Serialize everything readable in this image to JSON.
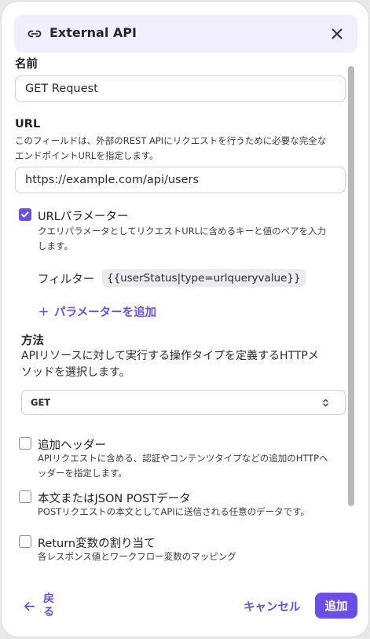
{
  "header": {
    "title": "External API"
  },
  "name_field": {
    "label": "名前",
    "value": "GET Request"
  },
  "url_field": {
    "label": "URL",
    "description_line1": "このフィールドは、外部のREST APIにリクエストを行うために必要な完全な",
    "description_line2": "エンドポイントURLを指定します。",
    "value": "https://example.com/api/users"
  },
  "url_params": {
    "checked": true,
    "label": "URLパラメーター",
    "description_line1": "クエリパラメータとしてリクエストURLに含めるキーと値のペアを入力",
    "description_line2": "します。",
    "filter_label": "フィルター",
    "filter_value": "{{userStatus|type=urlqueryvalue}}",
    "add_label": "パラメーターを追加"
  },
  "method": {
    "label": "方法",
    "description_line1": "APIリソースに対して実行する操作タイプを定義するHTTPメ",
    "description_line2": "ソッドを選択します。",
    "selected": "GET"
  },
  "options": [
    {
      "label": "追加ヘッダー",
      "description_line1": "APIリクエストに含める、認証やコンテンツタイプなどの追加のHTTPヘ",
      "description_line2": "ッダーを指定します。",
      "checked": false
    },
    {
      "label": "本文またはJSON POSTデータ",
      "description_line1": "POSTリクエストの本文としてAPIに送信される任意のデータです。",
      "description_line2": "",
      "checked": false
    },
    {
      "label": "Return変数の割り当て",
      "description_line1": "各レスポンス値とワークフロー変数のマッピング",
      "description_line2": "",
      "checked": false
    }
  ],
  "footer": {
    "back_label": "戻る",
    "cancel_label": "キャンセル",
    "add_label": "追加"
  },
  "colors": {
    "accent": "#6b4ee6",
    "header_bg": "#f1eefe"
  },
  "icons": {
    "header": "link-icon",
    "close": "close-icon",
    "back": "arrow-left-icon",
    "add_param": "plus-icon",
    "select": "chevron-updown-icon",
    "check": "check-icon"
  }
}
